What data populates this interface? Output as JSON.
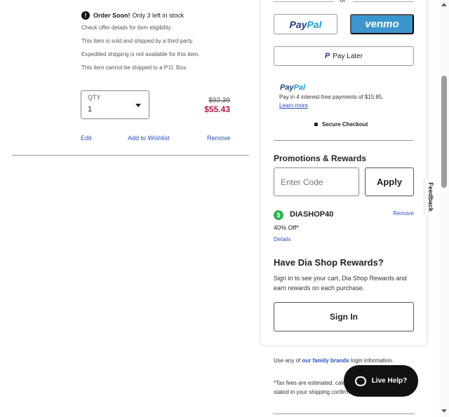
{
  "item": {
    "order_soon_bold": "Order Soon!",
    "order_soon_text": "Only 3 left in stock",
    "notes": [
      "Check offer details for item eligibility.",
      "This item is sold and shipped by a third party.",
      "Expedited shipping is not available for this item.",
      "This item cannot be shipped to a P.O. Box."
    ],
    "qty_label": "QTY",
    "qty_value": "1",
    "old_price": "$92.39",
    "new_price": "$55.43",
    "edit_label": "Edit",
    "wishlist_label": "Add to Wishlist",
    "remove_label": "Remove"
  },
  "summary": {
    "or_text": "or",
    "paypal_a": "Pay",
    "paypal_b": "Pal",
    "venmo_label": "venmo",
    "paylater_icon": "P",
    "paylater_label": "Pay Later",
    "pay4_text": "Pay in 4 interest-free payments of $15.85.",
    "learn_more": "Learn more",
    "secure_checkout": "Secure Checkout",
    "promo_title": "Promotions & Rewards",
    "code_placeholder": "Enter Code",
    "apply_label": "Apply",
    "promo_icon": "$",
    "promo_code": "DIASHOP40",
    "promo_remove": "Remove",
    "promo_discount": "40% Off*",
    "details_label": "Details",
    "rewards_title": "Have Dia Shop Rewards?",
    "rewards_text": "Sign in to see your cart, Dia Shop Rewards and earn rewards on each purchase.",
    "signin_label": "Sign In"
  },
  "footer": {
    "family_prefix": "Use any of",
    "family_link": "our family brands",
    "family_suffix": "login information.",
    "tax_text": "*Tax fees are estimated. calculated when your ord be stated in your shipping confirmation email."
  },
  "live_help_label": "Live Help?",
  "feedback_label": "Feedback",
  "colors": {
    "sale_price": "#b0184a",
    "link": "#2a4fbf",
    "venmo": "#3d95ce",
    "paypal_dark": "#253b80",
    "paypal_light": "#179bd7",
    "promo_icon": "#2bb24c"
  }
}
